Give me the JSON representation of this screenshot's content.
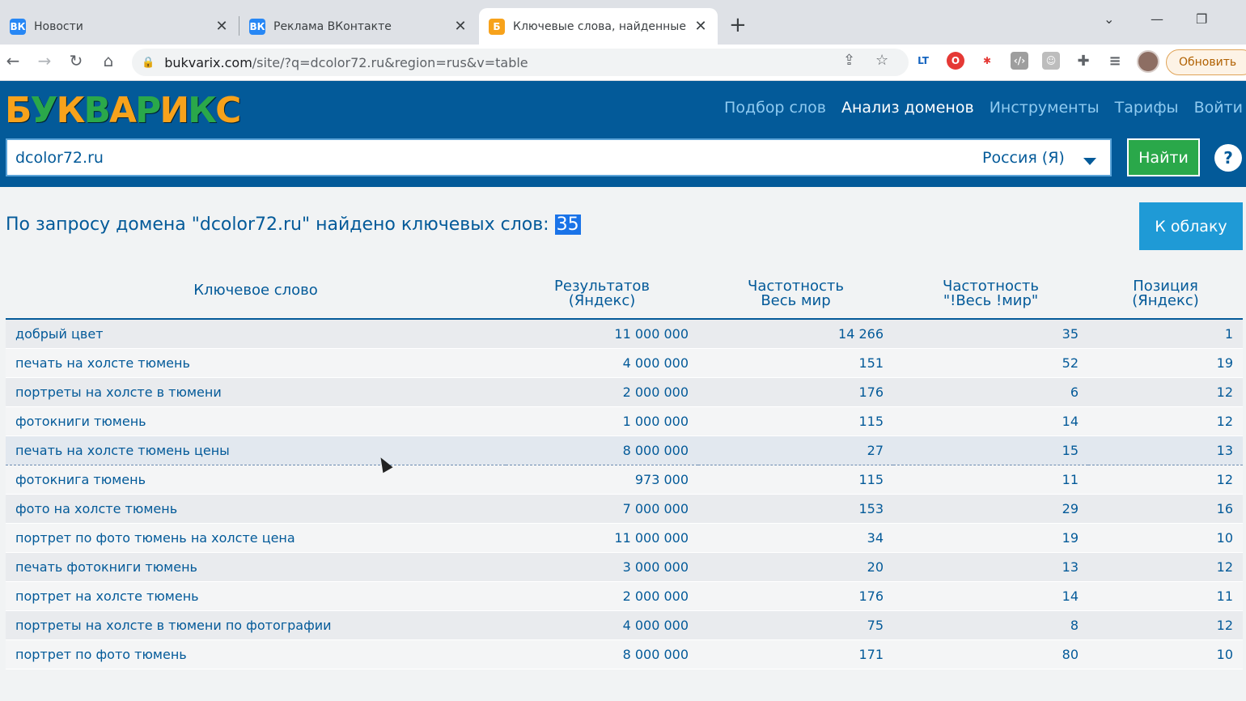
{
  "browser": {
    "tabs": [
      {
        "title": "Новости",
        "favicon": "ВК",
        "color": "#2787f5"
      },
      {
        "title": "Реклама ВКонтакте",
        "favicon": "ВК",
        "color": "#2787f5"
      },
      {
        "title": "Ключевые слова, найденные по",
        "favicon": "Б",
        "color": "#f7a21b"
      }
    ],
    "url_domain": "bukvarix.com",
    "url_path": "/site/?q=dcolor72.ru&region=rus&v=table",
    "update_label": "Обновить"
  },
  "site": {
    "logo_letters": [
      "Б",
      "У",
      "К",
      "В",
      "А",
      "Р",
      "И",
      "К",
      "С"
    ],
    "logo_colors": [
      "#f7a21b",
      "#2aa84a",
      "#f7a21b",
      "#2aa84a",
      "#f7a21b",
      "#2aa84a",
      "#f7a21b",
      "#2aa84a",
      "#f7a21b"
    ],
    "nav": [
      {
        "label": "Подбор слов",
        "active": false
      },
      {
        "label": "Анализ доменов",
        "active": true
      },
      {
        "label": "Инструменты",
        "active": false
      },
      {
        "label": "Тарифы",
        "active": false
      },
      {
        "label": "Войти",
        "active": false
      }
    ],
    "search": {
      "query": "dcolor72.ru",
      "region": "Россия (Я)",
      "find_label": "Найти",
      "help_label": "?"
    }
  },
  "results": {
    "prefix": "По запросу домена \"dcolor72.ru\" найдено ключевых слов: ",
    "count": "35",
    "cloud_label": "К облаку"
  },
  "table": {
    "headers": [
      {
        "line1": "Ключевое слово",
        "line2": ""
      },
      {
        "line1": "Результатов",
        "line2": "(Яндекс)"
      },
      {
        "line1": "Частотность",
        "line2": "Весь мир"
      },
      {
        "line1": "Частотность",
        "line2": "\"!Весь !мир\""
      },
      {
        "line1": "Позиция",
        "line2": "(Яндекс)"
      }
    ],
    "rows": [
      [
        "добрый цвет",
        "11 000 000",
        "14 266",
        "35",
        "1"
      ],
      [
        "печать на холсте тюмень",
        "4 000 000",
        "151",
        "52",
        "19"
      ],
      [
        "портреты на холсте в тюмени",
        "2 000 000",
        "176",
        "6",
        "12"
      ],
      [
        "фотокниги тюмень",
        "1 000 000",
        "115",
        "14",
        "12"
      ],
      [
        "печать на холсте тюмень цены",
        "8 000 000",
        "27",
        "15",
        "13"
      ],
      [
        "фотокнига тюмень",
        "973 000",
        "115",
        "11",
        "12"
      ],
      [
        "фото на холсте тюмень",
        "7 000 000",
        "153",
        "29",
        "16"
      ],
      [
        "портрет по фото тюмень на холсте цена",
        "11 000 000",
        "34",
        "19",
        "10"
      ],
      [
        "печать фотокниги тюмень",
        "3 000 000",
        "20",
        "13",
        "12"
      ],
      [
        "портрет на холсте тюмень",
        "2 000 000",
        "176",
        "14",
        "11"
      ],
      [
        "портреты на холсте в тюмени по фотографии",
        "4 000 000",
        "75",
        "8",
        "12"
      ],
      [
        "портрет по фото тюмень",
        "8 000 000",
        "171",
        "80",
        "10"
      ]
    ],
    "hover_row": 4
  }
}
